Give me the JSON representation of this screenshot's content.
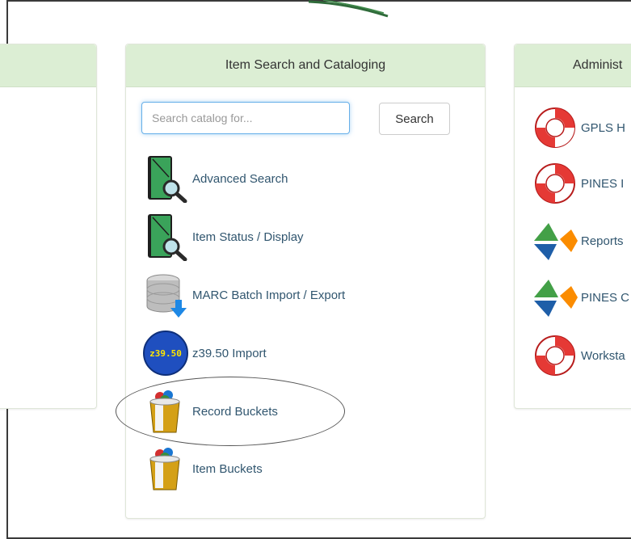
{
  "panels": {
    "left": {
      "title": ""
    },
    "middle": {
      "title": "Item Search and Cataloging"
    },
    "right": {
      "title": "Administ"
    }
  },
  "search": {
    "placeholder": "Search catalog for...",
    "value": "",
    "button_label": "Search"
  },
  "catalog_items": [
    {
      "label": "Advanced Search",
      "icon": "book-magnifier-icon"
    },
    {
      "label": "Item Status / Display",
      "icon": "book-magnifier-icon"
    },
    {
      "label": "MARC Batch Import / Export",
      "icon": "database-download-icon"
    },
    {
      "label": "z39.50 Import",
      "icon": "z3950-badge-icon",
      "badge_text": "z39.50"
    },
    {
      "label": "Record Buckets",
      "icon": "bucket-icon"
    },
    {
      "label": "Item Buckets",
      "icon": "bucket-icon"
    }
  ],
  "admin_items": [
    {
      "label": "GPLS H",
      "icon": "lifebuoy-icon"
    },
    {
      "label": "PINES I",
      "icon": "lifebuoy-icon"
    },
    {
      "label": "Reports",
      "icon": "pie-chart-icon"
    },
    {
      "label": "PINES C",
      "icon": "pie-chart-icon"
    },
    {
      "label": "Worksta",
      "icon": "lifebuoy-icon"
    }
  ],
  "colors": {
    "panel_header_bg": "#dceed4",
    "link_text": "#31566f",
    "focus_ring": "#66afe9"
  }
}
